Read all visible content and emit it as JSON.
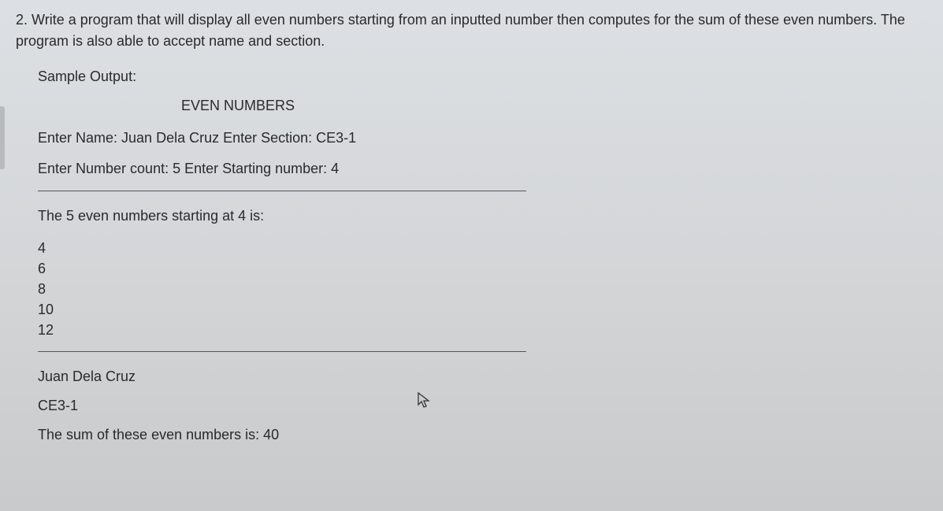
{
  "question": {
    "number": "2.",
    "text": "Write a program that will display all even numbers starting from an inputted number then computes for the sum of these even numbers. The program is also able to accept name and section."
  },
  "sample_output_label": "Sample Output:",
  "title": "EVEN NUMBERS",
  "prompts": {
    "line1": "Enter Name: Juan Dela Cruz Enter Section: CE3-1",
    "line2": "Enter Number count: 5 Enter Starting number: 4"
  },
  "result_label": "The 5 even numbers starting at 4 is:",
  "numbers": [
    "4",
    "6",
    "8",
    "10",
    "12"
  ],
  "footer": {
    "name": "Juan Dela Cruz",
    "section": "CE3-1",
    "sum_line": "The sum of these even numbers is: 40"
  }
}
